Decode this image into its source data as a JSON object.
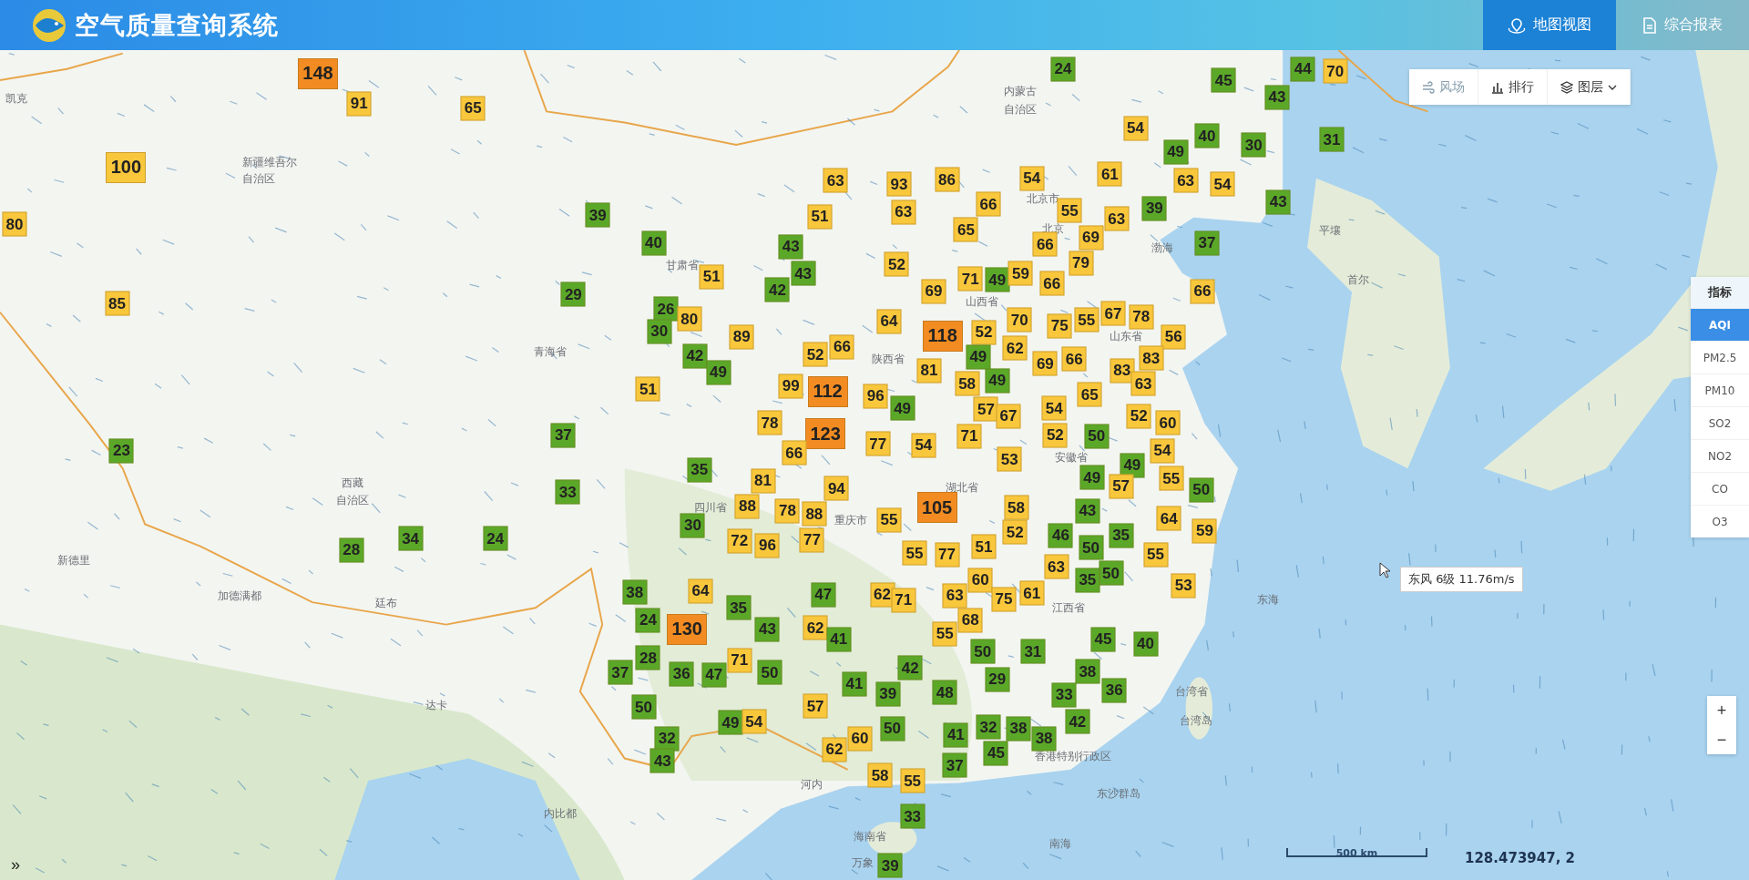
{
  "header": {
    "title": "空气质量查询系统",
    "nav": [
      {
        "label": "地图视图",
        "kind": "map",
        "selected": true
      },
      {
        "label": "综合报表",
        "kind": "report",
        "selected": false
      }
    ]
  },
  "toolbar": [
    {
      "label": "风场",
      "kind": "wind",
      "disabled": true
    },
    {
      "label": "排行",
      "kind": "ranking",
      "disabled": false
    },
    {
      "label": "图层",
      "kind": "layers",
      "disabled": false
    }
  ],
  "indicators": {
    "title": "指标",
    "items": [
      {
        "label": "AQI",
        "selected": true
      },
      {
        "label": "PM2.5",
        "selected": false
      },
      {
        "label": "PM10",
        "selected": false
      },
      {
        "label": "SO2",
        "selected": false
      },
      {
        "label": "NO2",
        "selected": false
      },
      {
        "label": "CO",
        "selected": false
      },
      {
        "label": "O3",
        "selected": false
      }
    ]
  },
  "place_labels": [
    "凯克",
    "新疆维吾尔",
    "自治区",
    "内蒙古",
    "自治区",
    "甘肃省",
    "青海省",
    "西藏",
    "自治区",
    "陕西省",
    "山西省",
    "北京市",
    "北京",
    "渤海",
    "山东省",
    "四川省",
    "重庆市",
    "湖北省",
    "安徽省",
    "江西省",
    "香港特别行政区",
    "台湾省",
    "台湾岛",
    "东沙群岛",
    "海南省",
    "南海",
    "东海",
    "平壤",
    "首尔",
    "河内",
    "内比都",
    "万象",
    "达卡",
    "加德满都",
    "廷布",
    "新德里"
  ],
  "markers": [
    {
      "value": "148",
      "color": "#f28c22"
    },
    {
      "value": "91",
      "color": "#f9c73c"
    },
    {
      "value": "65",
      "color": "#f9c73c"
    },
    {
      "value": "100",
      "color": "#f9c73c"
    },
    {
      "value": "80",
      "color": "#f9c73c"
    },
    {
      "value": "85",
      "color": "#f9c73c"
    },
    {
      "value": "23",
      "color": "#5ba829"
    },
    {
      "value": "28",
      "color": "#5ba829"
    },
    {
      "value": "34",
      "color": "#5ba829"
    },
    {
      "value": "24",
      "color": "#5ba829"
    },
    {
      "value": "39",
      "color": "#5ba829"
    },
    {
      "value": "40",
      "color": "#5ba829"
    },
    {
      "value": "29",
      "color": "#5ba829"
    },
    {
      "value": "26",
      "color": "#5ba829"
    },
    {
      "value": "30",
      "color": "#5ba829"
    },
    {
      "value": "80",
      "color": "#f9c73c"
    },
    {
      "value": "51",
      "color": "#f9c73c"
    },
    {
      "value": "89",
      "color": "#f9c73c"
    },
    {
      "value": "42",
      "color": "#5ba829"
    },
    {
      "value": "49",
      "color": "#5ba829"
    },
    {
      "value": "51",
      "color": "#f9c73c"
    },
    {
      "value": "37",
      "color": "#5ba829"
    },
    {
      "value": "33",
      "color": "#5ba829"
    },
    {
      "value": "63",
      "color": "#f9c73c"
    },
    {
      "value": "51",
      "color": "#f9c73c"
    },
    {
      "value": "43",
      "color": "#5ba829"
    },
    {
      "value": "43",
      "color": "#5ba829"
    },
    {
      "value": "42",
      "color": "#5ba829"
    },
    {
      "value": "93",
      "color": "#f9c73c"
    },
    {
      "value": "63",
      "color": "#f9c73c"
    },
    {
      "value": "86",
      "color": "#f9c73c"
    },
    {
      "value": "52",
      "color": "#f9c73c"
    },
    {
      "value": "64",
      "color": "#f9c73c"
    },
    {
      "value": "52",
      "color": "#f9c73c"
    },
    {
      "value": "66",
      "color": "#f9c73c"
    },
    {
      "value": "99",
      "color": "#f9c73c"
    },
    {
      "value": "112",
      "color": "#f28c22"
    },
    {
      "value": "96",
      "color": "#f9c73c"
    },
    {
      "value": "49",
      "color": "#5ba829"
    },
    {
      "value": "78",
      "color": "#f9c73c"
    },
    {
      "value": "123",
      "color": "#f28c22"
    },
    {
      "value": "66",
      "color": "#f9c73c"
    },
    {
      "value": "77",
      "color": "#f9c73c"
    },
    {
      "value": "54",
      "color": "#f9c73c"
    },
    {
      "value": "24",
      "color": "#5ba829"
    },
    {
      "value": "45",
      "color": "#5ba829"
    },
    {
      "value": "44",
      "color": "#5ba829"
    },
    {
      "value": "70",
      "color": "#f9c73c"
    },
    {
      "value": "43",
      "color": "#5ba829"
    },
    {
      "value": "54",
      "color": "#f9c73c"
    },
    {
      "value": "40",
      "color": "#5ba829"
    },
    {
      "value": "49",
      "color": "#5ba829"
    },
    {
      "value": "30",
      "color": "#5ba829"
    },
    {
      "value": "31",
      "color": "#5ba829"
    },
    {
      "value": "54",
      "color": "#f9c73c"
    },
    {
      "value": "61",
      "color": "#f9c73c"
    },
    {
      "value": "63",
      "color": "#f9c73c"
    },
    {
      "value": "54",
      "color": "#f9c73c"
    },
    {
      "value": "66",
      "color": "#f9c73c"
    },
    {
      "value": "55",
      "color": "#f9c73c"
    },
    {
      "value": "63",
      "color": "#f9c73c"
    },
    {
      "value": "39",
      "color": "#5ba829"
    },
    {
      "value": "43",
      "color": "#5ba829"
    },
    {
      "value": "65",
      "color": "#f9c73c"
    },
    {
      "value": "66",
      "color": "#f9c73c"
    },
    {
      "value": "69",
      "color": "#f9c73c"
    },
    {
      "value": "37",
      "color": "#5ba829"
    },
    {
      "value": "79",
      "color": "#f9c73c"
    },
    {
      "value": "71",
      "color": "#f9c73c"
    },
    {
      "value": "49",
      "color": "#5ba829"
    },
    {
      "value": "59",
      "color": "#f9c73c"
    },
    {
      "value": "69",
      "color": "#f9c73c"
    },
    {
      "value": "66",
      "color": "#f9c73c"
    },
    {
      "value": "66",
      "color": "#f9c73c"
    },
    {
      "value": "118",
      "color": "#f28c22"
    },
    {
      "value": "52",
      "color": "#f9c73c"
    },
    {
      "value": "70",
      "color": "#f9c73c"
    },
    {
      "value": "75",
      "color": "#f9c73c"
    },
    {
      "value": "55",
      "color": "#f9c73c"
    },
    {
      "value": "67",
      "color": "#f9c73c"
    },
    {
      "value": "78",
      "color": "#f9c73c"
    },
    {
      "value": "56",
      "color": "#f9c73c"
    },
    {
      "value": "49",
      "color": "#5ba829"
    },
    {
      "value": "62",
      "color": "#f9c73c"
    },
    {
      "value": "81",
      "color": "#f9c73c"
    },
    {
      "value": "69",
      "color": "#f9c73c"
    },
    {
      "value": "66",
      "color": "#f9c73c"
    },
    {
      "value": "83",
      "color": "#f9c73c"
    },
    {
      "value": "83",
      "color": "#f9c73c"
    },
    {
      "value": "58",
      "color": "#f9c73c"
    },
    {
      "value": "49",
      "color": "#5ba829"
    },
    {
      "value": "63",
      "color": "#f9c73c"
    },
    {
      "value": "65",
      "color": "#f9c73c"
    },
    {
      "value": "57",
      "color": "#f9c73c"
    },
    {
      "value": "67",
      "color": "#f9c73c"
    },
    {
      "value": "54",
      "color": "#f9c73c"
    },
    {
      "value": "52",
      "color": "#f9c73c"
    },
    {
      "value": "60",
      "color": "#f9c73c"
    },
    {
      "value": "71",
      "color": "#f9c73c"
    },
    {
      "value": "52",
      "color": "#f9c73c"
    },
    {
      "value": "50",
      "color": "#5ba829"
    },
    {
      "value": "54",
      "color": "#f9c73c"
    },
    {
      "value": "53",
      "color": "#f9c73c"
    },
    {
      "value": "49",
      "color": "#5ba829"
    },
    {
      "value": "49",
      "color": "#5ba829"
    },
    {
      "value": "57",
      "color": "#f9c73c"
    },
    {
      "value": "55",
      "color": "#f9c73c"
    },
    {
      "value": "50",
      "color": "#5ba829"
    },
    {
      "value": "35",
      "color": "#5ba829"
    },
    {
      "value": "81",
      "color": "#f9c73c"
    },
    {
      "value": "94",
      "color": "#f9c73c"
    },
    {
      "value": "30",
      "color": "#5ba829"
    },
    {
      "value": "88",
      "color": "#f9c73c"
    },
    {
      "value": "78",
      "color": "#f9c73c"
    },
    {
      "value": "88",
      "color": "#f9c73c"
    },
    {
      "value": "55",
      "color": "#f9c73c"
    },
    {
      "value": "105",
      "color": "#f28c22"
    },
    {
      "value": "58",
      "color": "#f9c73c"
    },
    {
      "value": "52",
      "color": "#f9c73c"
    },
    {
      "value": "43",
      "color": "#5ba829"
    },
    {
      "value": "64",
      "color": "#f9c73c"
    },
    {
      "value": "72",
      "color": "#f9c73c"
    },
    {
      "value": "96",
      "color": "#f9c73c"
    },
    {
      "value": "77",
      "color": "#f9c73c"
    },
    {
      "value": "55",
      "color": "#f9c73c"
    },
    {
      "value": "77",
      "color": "#f9c73c"
    },
    {
      "value": "51",
      "color": "#f9c73c"
    },
    {
      "value": "46",
      "color": "#5ba829"
    },
    {
      "value": "50",
      "color": "#5ba829"
    },
    {
      "value": "35",
      "color": "#5ba829"
    },
    {
      "value": "55",
      "color": "#f9c73c"
    },
    {
      "value": "59",
      "color": "#f9c73c"
    },
    {
      "value": "63",
      "color": "#f9c73c"
    },
    {
      "value": "50",
      "color": "#5ba829"
    },
    {
      "value": "35",
      "color": "#5ba829"
    },
    {
      "value": "53",
      "color": "#f9c73c"
    },
    {
      "value": "38",
      "color": "#5ba829"
    },
    {
      "value": "64",
      "color": "#f9c73c"
    },
    {
      "value": "35",
      "color": "#5ba829"
    },
    {
      "value": "47",
      "color": "#5ba829"
    },
    {
      "value": "62",
      "color": "#f9c73c"
    },
    {
      "value": "71",
      "color": "#f9c73c"
    },
    {
      "value": "60",
      "color": "#f9c73c"
    },
    {
      "value": "63",
      "color": "#f9c73c"
    },
    {
      "value": "75",
      "color": "#f9c73c"
    },
    {
      "value": "61",
      "color": "#f9c73c"
    },
    {
      "value": "24",
      "color": "#5ba829"
    },
    {
      "value": "130",
      "color": "#f28c22"
    },
    {
      "value": "43",
      "color": "#5ba829"
    },
    {
      "value": "62",
      "color": "#f9c73c"
    },
    {
      "value": "41",
      "color": "#5ba829"
    },
    {
      "value": "68",
      "color": "#f9c73c"
    },
    {
      "value": "55",
      "color": "#f9c73c"
    },
    {
      "value": "45",
      "color": "#5ba829"
    },
    {
      "value": "40",
      "color": "#5ba829"
    },
    {
      "value": "28",
      "color": "#5ba829"
    },
    {
      "value": "37",
      "color": "#5ba829"
    },
    {
      "value": "36",
      "color": "#5ba829"
    },
    {
      "value": "47",
      "color": "#5ba829"
    },
    {
      "value": "71",
      "color": "#f9c73c"
    },
    {
      "value": "50",
      "color": "#5ba829"
    },
    {
      "value": "50",
      "color": "#5ba829"
    },
    {
      "value": "31",
      "color": "#5ba829"
    },
    {
      "value": "42",
      "color": "#5ba829"
    },
    {
      "value": "41",
      "color": "#5ba829"
    },
    {
      "value": "39",
      "color": "#5ba829"
    },
    {
      "value": "48",
      "color": "#5ba829"
    },
    {
      "value": "29",
      "color": "#5ba829"
    },
    {
      "value": "38",
      "color": "#5ba829"
    },
    {
      "value": "33",
      "color": "#5ba829"
    },
    {
      "value": "36",
      "color": "#5ba829"
    },
    {
      "value": "57",
      "color": "#f9c73c"
    },
    {
      "value": "50",
      "color": "#5ba829"
    },
    {
      "value": "49",
      "color": "#5ba829"
    },
    {
      "value": "54",
      "color": "#f9c73c"
    },
    {
      "value": "42",
      "color": "#5ba829"
    },
    {
      "value": "32",
      "color": "#5ba829"
    },
    {
      "value": "43",
      "color": "#5ba829"
    },
    {
      "value": "62",
      "color": "#f9c73c"
    },
    {
      "value": "60",
      "color": "#f9c73c"
    },
    {
      "value": "50",
      "color": "#5ba829"
    },
    {
      "value": "41",
      "color": "#5ba829"
    },
    {
      "value": "32",
      "color": "#5ba829"
    },
    {
      "value": "38",
      "color": "#5ba829"
    },
    {
      "value": "38",
      "color": "#5ba829"
    },
    {
      "value": "45",
      "color": "#5ba829"
    },
    {
      "value": "37",
      "color": "#5ba829"
    },
    {
      "value": "58",
      "color": "#f9c73c"
    },
    {
      "value": "55",
      "color": "#f9c73c"
    },
    {
      "value": "33",
      "color": "#5ba829"
    },
    {
      "value": "39",
      "color": "#5ba829"
    }
  ],
  "tooltip": "东风 6级 11.76m/s",
  "zoom": {
    "in": "+",
    "out": "−"
  },
  "expand_button": "»",
  "scale": "500 km",
  "coordinates": "128.473947, 2"
}
